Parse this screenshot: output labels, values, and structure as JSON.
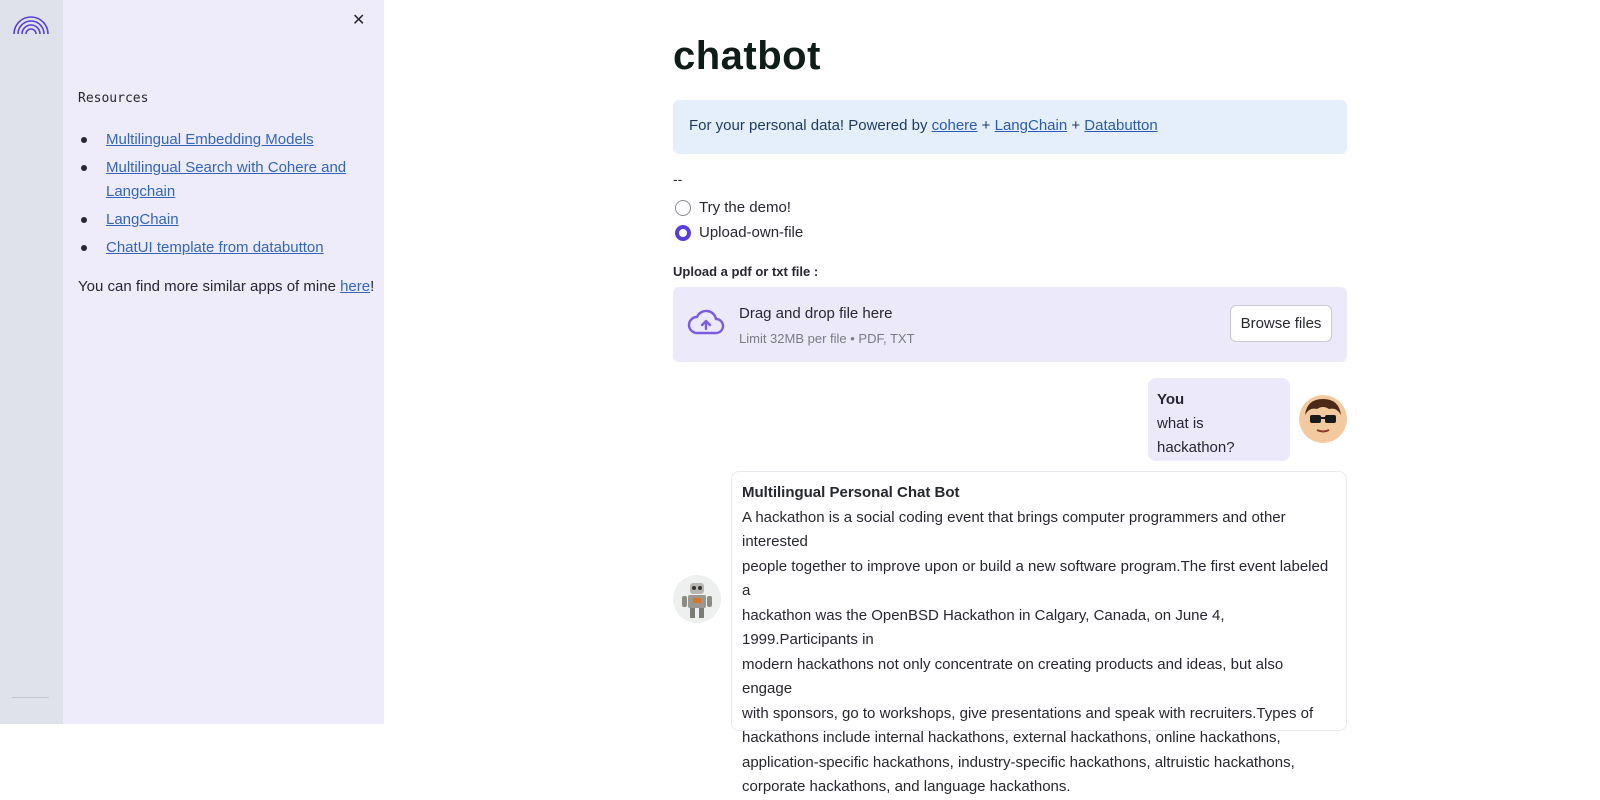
{
  "sidebar": {
    "close_icon": "close-icon",
    "heading": "Resources",
    "links": [
      {
        "label": "Multilingual Embedding Models"
      },
      {
        "label": "Multilingual Search with Cohere and Langchain"
      },
      {
        "label": "LangChain"
      },
      {
        "label": "ChatUI template from databutton"
      }
    ],
    "more_prefix": "You can find more similar apps of mine ",
    "more_link": "here",
    "more_suffix": "!"
  },
  "main": {
    "title": "chatbot",
    "info": {
      "prefix": "For your personal data! Powered by ",
      "link1": "cohere",
      "sep1": " + ",
      "link2": "LangChain",
      "sep2": " + ",
      "link3": "Databutton"
    },
    "dash": "--",
    "radio_options": [
      {
        "label": "Try the demo!",
        "selected": false
      },
      {
        "label": "Upload-own-file",
        "selected": true
      }
    ],
    "upload": {
      "label": "Upload a pdf or txt file :",
      "drag_text": "Drag and drop file here",
      "limit_text": "Limit 32MB per file • PDF, TXT",
      "browse_label": "Browse files"
    }
  },
  "chat": {
    "user": {
      "name": "You",
      "text": "what is hackathon?"
    },
    "bot": {
      "name": "Multilingual Personal Chat Bot",
      "lines": [
        "A hackathon is a social coding event that brings computer programmers and other interested",
        "people together to improve upon or build a new software program.The first event labeled a",
        "hackathon was the OpenBSD Hackathon in Calgary, Canada, on June 4, 1999.Participants in",
        "modern hackathons not only concentrate on creating products and ideas, but also engage",
        "with sponsors, go to workshops, give presentations and speak with recruiters.Types of",
        "hackathons include internal hackathons, external hackathons, online hackathons,",
        "application-specific hackathons, industry-specific hackathons, altruistic hackathons,",
        "corporate hackathons, and language hackathons."
      ]
    }
  },
  "colors": {
    "accent": "#5b3ddc",
    "sidebar_bg": "#eeecfb",
    "link": "#3366bb",
    "info_bg": "#e5effb"
  }
}
